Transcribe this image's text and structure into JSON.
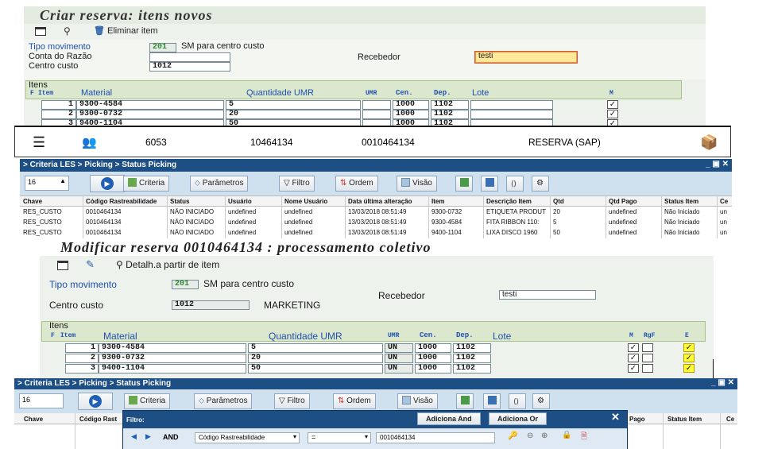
{
  "panel1": {
    "title": "Criar reserva: itens novos",
    "toolbar_delete": "Eliminar item",
    "labels": {
      "tipo": "Tipo movimento",
      "conta": "Conta do Razão",
      "centro": "Centro custo",
      "receb": "Recebedor"
    },
    "values": {
      "tipo_code": "201",
      "tipo_desc": "SM para centro custo",
      "centro": "1012",
      "receb": "testi"
    },
    "itens_title": "Itens",
    "cols": {
      "f": "F",
      "item": "Item",
      "material": "Material",
      "qty": "Quantidade UMR",
      "umr": "UMR",
      "cen": "Cen.",
      "dep": "Dep.",
      "lote": "Lote",
      "m": "M"
    },
    "rows": [
      {
        "item": "1",
        "material": "9300-4584",
        "qty": "5",
        "cen": "1000",
        "dep": "1102"
      },
      {
        "item": "2",
        "material": "9300-0732",
        "qty": "20",
        "cen": "1000",
        "dep": "1102"
      },
      {
        "item": "3",
        "material": "9400-1104",
        "qty": "50",
        "cen": "1000",
        "dep": "1102"
      }
    ]
  },
  "mobile": {
    "num1": "6053",
    "num2": "10464134",
    "num3": "0010464134",
    "label": "RESERVA (SAP)"
  },
  "les1": {
    "breadcrumb": "> Criteria LES > Picking > Status Picking",
    "page": "16",
    "buttons": {
      "criteria": "Criteria",
      "param": "Parâmetros",
      "filtro": "Filtro",
      "ordem": "Ordem",
      "visao": "Visão"
    },
    "headers": [
      "Chave",
      "Código Rastreabilidade",
      "Status",
      "Usuário",
      "Nome Usuário",
      "Data última alteração",
      "Item",
      "Descrição Item",
      "Qtd",
      "Qtd Pago",
      "Status Item",
      "Ce"
    ],
    "rows": [
      [
        "RES_CUSTO",
        "0010464134",
        "NÃO INICIADO",
        "undefined",
        "undefined",
        "13/03/2018 08:51:49",
        "9300-0732",
        "ETIQUETA PRODUT",
        "20",
        "undefined",
        "Não Iniciado",
        "un"
      ],
      [
        "RES_CUSTO",
        "0010464134",
        "NÃO INICIADO",
        "undefined",
        "undefined",
        "13/03/2018 08:51:49",
        "9300-4584",
        "FITA RIBBON 110:",
        "5",
        "undefined",
        "Não Iniciado",
        "un"
      ],
      [
        "RES_CUSTO",
        "0010464134",
        "NÃO INICIADO",
        "undefined",
        "undefined",
        "13/03/2018 08:51:49",
        "9400-1104",
        "LIXA DISCO 1960",
        "50",
        "undefined",
        "Não Iniciado",
        "un"
      ]
    ]
  },
  "panel2": {
    "title": "Modificar reserva 0010464134 : processamento coletivo",
    "toolbar_detail": "Detalh.a partir de item",
    "labels": {
      "tipo": "Tipo movimento",
      "centro": "Centro custo",
      "receb": "Recebedor"
    },
    "values": {
      "tipo_code": "201",
      "tipo_desc": "SM para centro custo",
      "centro": "1012",
      "centro_desc": "MARKETING",
      "receb": "testi"
    },
    "itens_title": "Itens",
    "cols": {
      "f": "F",
      "item": "Item",
      "material": "Material",
      "qty": "Quantidade UMR",
      "umr": "UMR",
      "cen": "Cen.",
      "dep": "Dep.",
      "lote": "Lote",
      "m": "M",
      "rgf": "RgF",
      "e": "E"
    },
    "rows": [
      {
        "item": "1",
        "material": "9300-4584",
        "qty": "5",
        "umr": "UN",
        "cen": "1000",
        "dep": "1102"
      },
      {
        "item": "2",
        "material": "9300-0732",
        "qty": "20",
        "umr": "UN",
        "cen": "1000",
        "dep": "1102"
      },
      {
        "item": "3",
        "material": "9400-1104",
        "qty": "50",
        "umr": "UN",
        "cen": "1000",
        "dep": "1102"
      }
    ]
  },
  "les2": {
    "breadcrumb": "> Criteria LES > Picking > Status Picking",
    "page": "16",
    "buttons": {
      "criteria": "Criteria",
      "param": "Parâmetros",
      "filtro": "Filtro",
      "ordem": "Ordem",
      "visao": "Visão"
    },
    "headers": {
      "chave": "Chave",
      "codigo": "Código Rast",
      "pago": "Pago",
      "status": "Status Item",
      "ce": "Ce"
    },
    "filter": {
      "title": "Filtro:",
      "add_and": "Adiciona And",
      "add_or": "Adiciona Or",
      "op": "AND",
      "field": "Código Rastreabilidade",
      "cmp": "=",
      "value": "0010464134"
    }
  },
  "colors": {
    "les_blue": "#1d4f85",
    "sap_green": "#dbe8cd",
    "highlight": "#ffff33"
  }
}
